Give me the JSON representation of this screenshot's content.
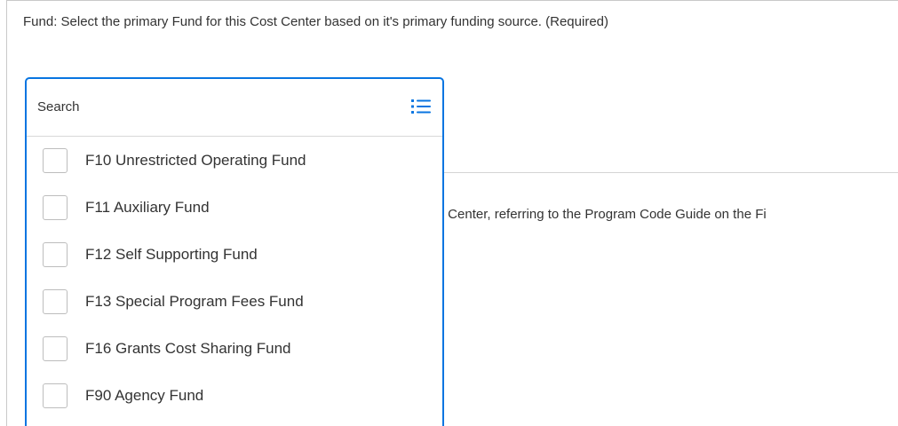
{
  "fund_field": {
    "label": "Fund: Select the primary Fund for this Cost Center based on it's primary funding source. (Required)"
  },
  "program_field": {
    "label_partial": "ost Center, referring to the Program Code Guide on the Fi"
  },
  "dropdown": {
    "search_placeholder": "Search",
    "list_icon": "list-view-icon",
    "accent_color": "#0875e1",
    "options": [
      {
        "label": "F10 Unrestricted Operating Fund",
        "checked": false
      },
      {
        "label": "F11 Auxiliary Fund",
        "checked": false
      },
      {
        "label": "F12 Self Supporting Fund",
        "checked": false
      },
      {
        "label": "F13 Special Program Fees Fund",
        "checked": false
      },
      {
        "label": "F16 Grants Cost Sharing Fund",
        "checked": false
      },
      {
        "label": "F90 Agency Fund",
        "checked": false
      }
    ]
  }
}
